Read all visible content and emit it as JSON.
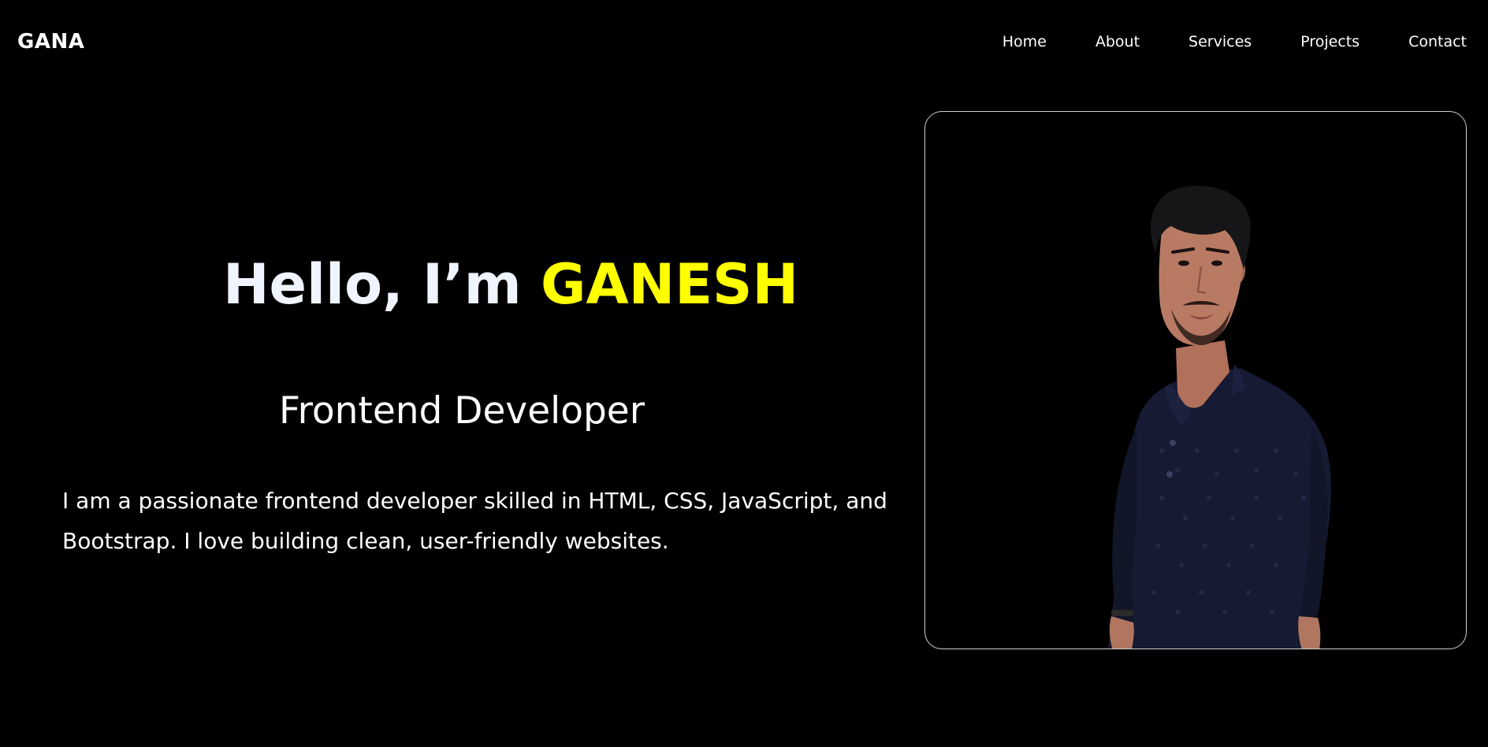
{
  "navbar": {
    "logo": "GANA",
    "links": [
      "Home",
      "About",
      "Services",
      "Projects",
      "Contact"
    ]
  },
  "hero": {
    "greeting": "Hello, I’m ",
    "name": "GANESH",
    "role": "Frontend Developer",
    "description": "I am a passionate frontend developer skilled in HTML, CSS, JavaScript, and Bootstrap. I love building clean, user-friendly websites."
  },
  "colors": {
    "background": "#000000",
    "accent": "#ffff00",
    "text": "#ffffff"
  }
}
